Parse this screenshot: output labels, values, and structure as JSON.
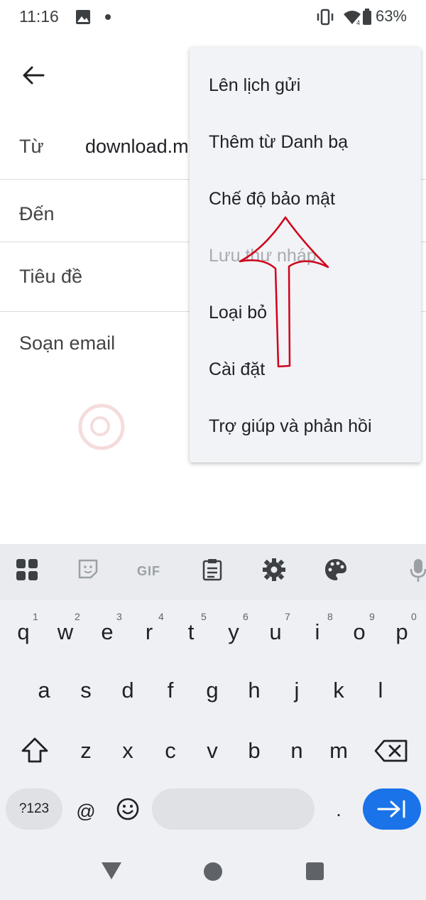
{
  "status_bar": {
    "time": "11:16",
    "battery": "63%"
  },
  "compose": {
    "from_label": "Từ",
    "from_value": "download.m",
    "to_label": "Đến",
    "subject_label": "Tiêu đề",
    "body_placeholder": "Soạn email"
  },
  "menu": {
    "items": [
      "Lên lịch gửi",
      "Thêm từ Danh bạ",
      "Chế độ bảo mật",
      "Lưu thư nháp",
      "Loại bỏ",
      "Cài đặt",
      "Trợ giúp và phản hồi"
    ]
  },
  "keyboard": {
    "toolbar_icons": [
      "apps-icon",
      "sticker-icon",
      "gif-icon",
      "clipboard-icon",
      "settings-icon",
      "theme-icon",
      "mic-icon"
    ],
    "gif_label": "GIF",
    "row1": [
      "q",
      "w",
      "e",
      "r",
      "t",
      "y",
      "u",
      "i",
      "o",
      "p"
    ],
    "row1_hints": [
      "1",
      "2",
      "3",
      "4",
      "5",
      "6",
      "7",
      "8",
      "9",
      "0"
    ],
    "row2": [
      "a",
      "s",
      "d",
      "f",
      "g",
      "h",
      "j",
      "k",
      "l"
    ],
    "row3": [
      "z",
      "x",
      "c",
      "v",
      "b",
      "n",
      "m"
    ],
    "symbols_label": "?123",
    "at_label": "@",
    "period_label": "."
  },
  "accent_color": "#1a73e8",
  "annotation_color": "#d0021b"
}
